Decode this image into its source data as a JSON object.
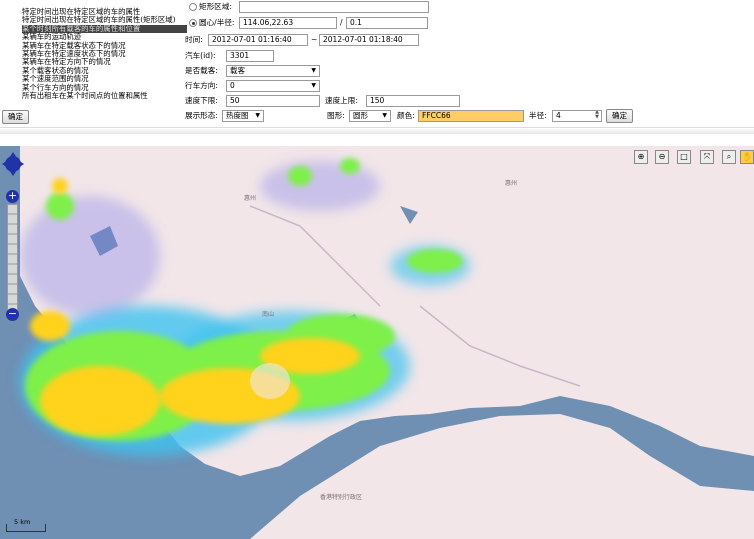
{
  "menu": {
    "items": [
      "特定时间出现在特定区域的车的属性",
      "特定时间出现在特定区域的车的属性(矩形区域)",
      "某个时刻所有载客的车的属性和位置",
      "某辆车的运动轨迹",
      "某辆车在特定载客状态下的情况",
      "某辆车在特定速度状态下的情况",
      "某辆车在特定方向下的情况",
      "某个载客状态的情况",
      "某个速度范围的情况",
      "某个行车方向的情况",
      "所有出租车在某个时间点的位置和属性"
    ],
    "confirm": "确定"
  },
  "form": {
    "rect_label": "矩形区域:",
    "circle_label": "圆心/半径:",
    "center_value": "114.06,22.63",
    "slash": "/",
    "radius_value": "0.1",
    "time_label": "时间:",
    "time_start": "2012-07-01 01:16:40",
    "time_sep": "~",
    "time_end": "2012-07-01 01:18:40",
    "car_label": "汽车(id):",
    "car_value": "3301",
    "loaded_label": "是否载客:",
    "loaded_value": "载客",
    "direction_label": "行车方向:",
    "direction_value": "0",
    "speed_min_label": "速度下限:",
    "speed_min_value": "50",
    "speed_max_label": "速度上限:",
    "speed_max_value": "150",
    "display_label": "展示形态:",
    "display_value": "热度图",
    "shape_label": "图形:",
    "shape_value": "圆形",
    "color_label": "颜色:",
    "color_value": "FFCC66",
    "radius2_label": "半径:",
    "radius2_value": "4",
    "confirm": "确定"
  },
  "map": {
    "scale_label": "5 km",
    "place_labels": [
      "惠州",
      "南山",
      "深圳",
      "香港特别行政区"
    ],
    "colors": {
      "water": "#6f8fb3",
      "land": "#f2e6e9",
      "heat_hot": "#ffd21f",
      "heat_mid": "#7ef04a",
      "heat_cool": "#3ec3f0"
    }
  },
  "tools": [
    "zoom-in-icon",
    "zoom-out-icon",
    "rectangle-icon",
    "lasso-icon",
    "magnify-icon",
    "pan-icon"
  ]
}
